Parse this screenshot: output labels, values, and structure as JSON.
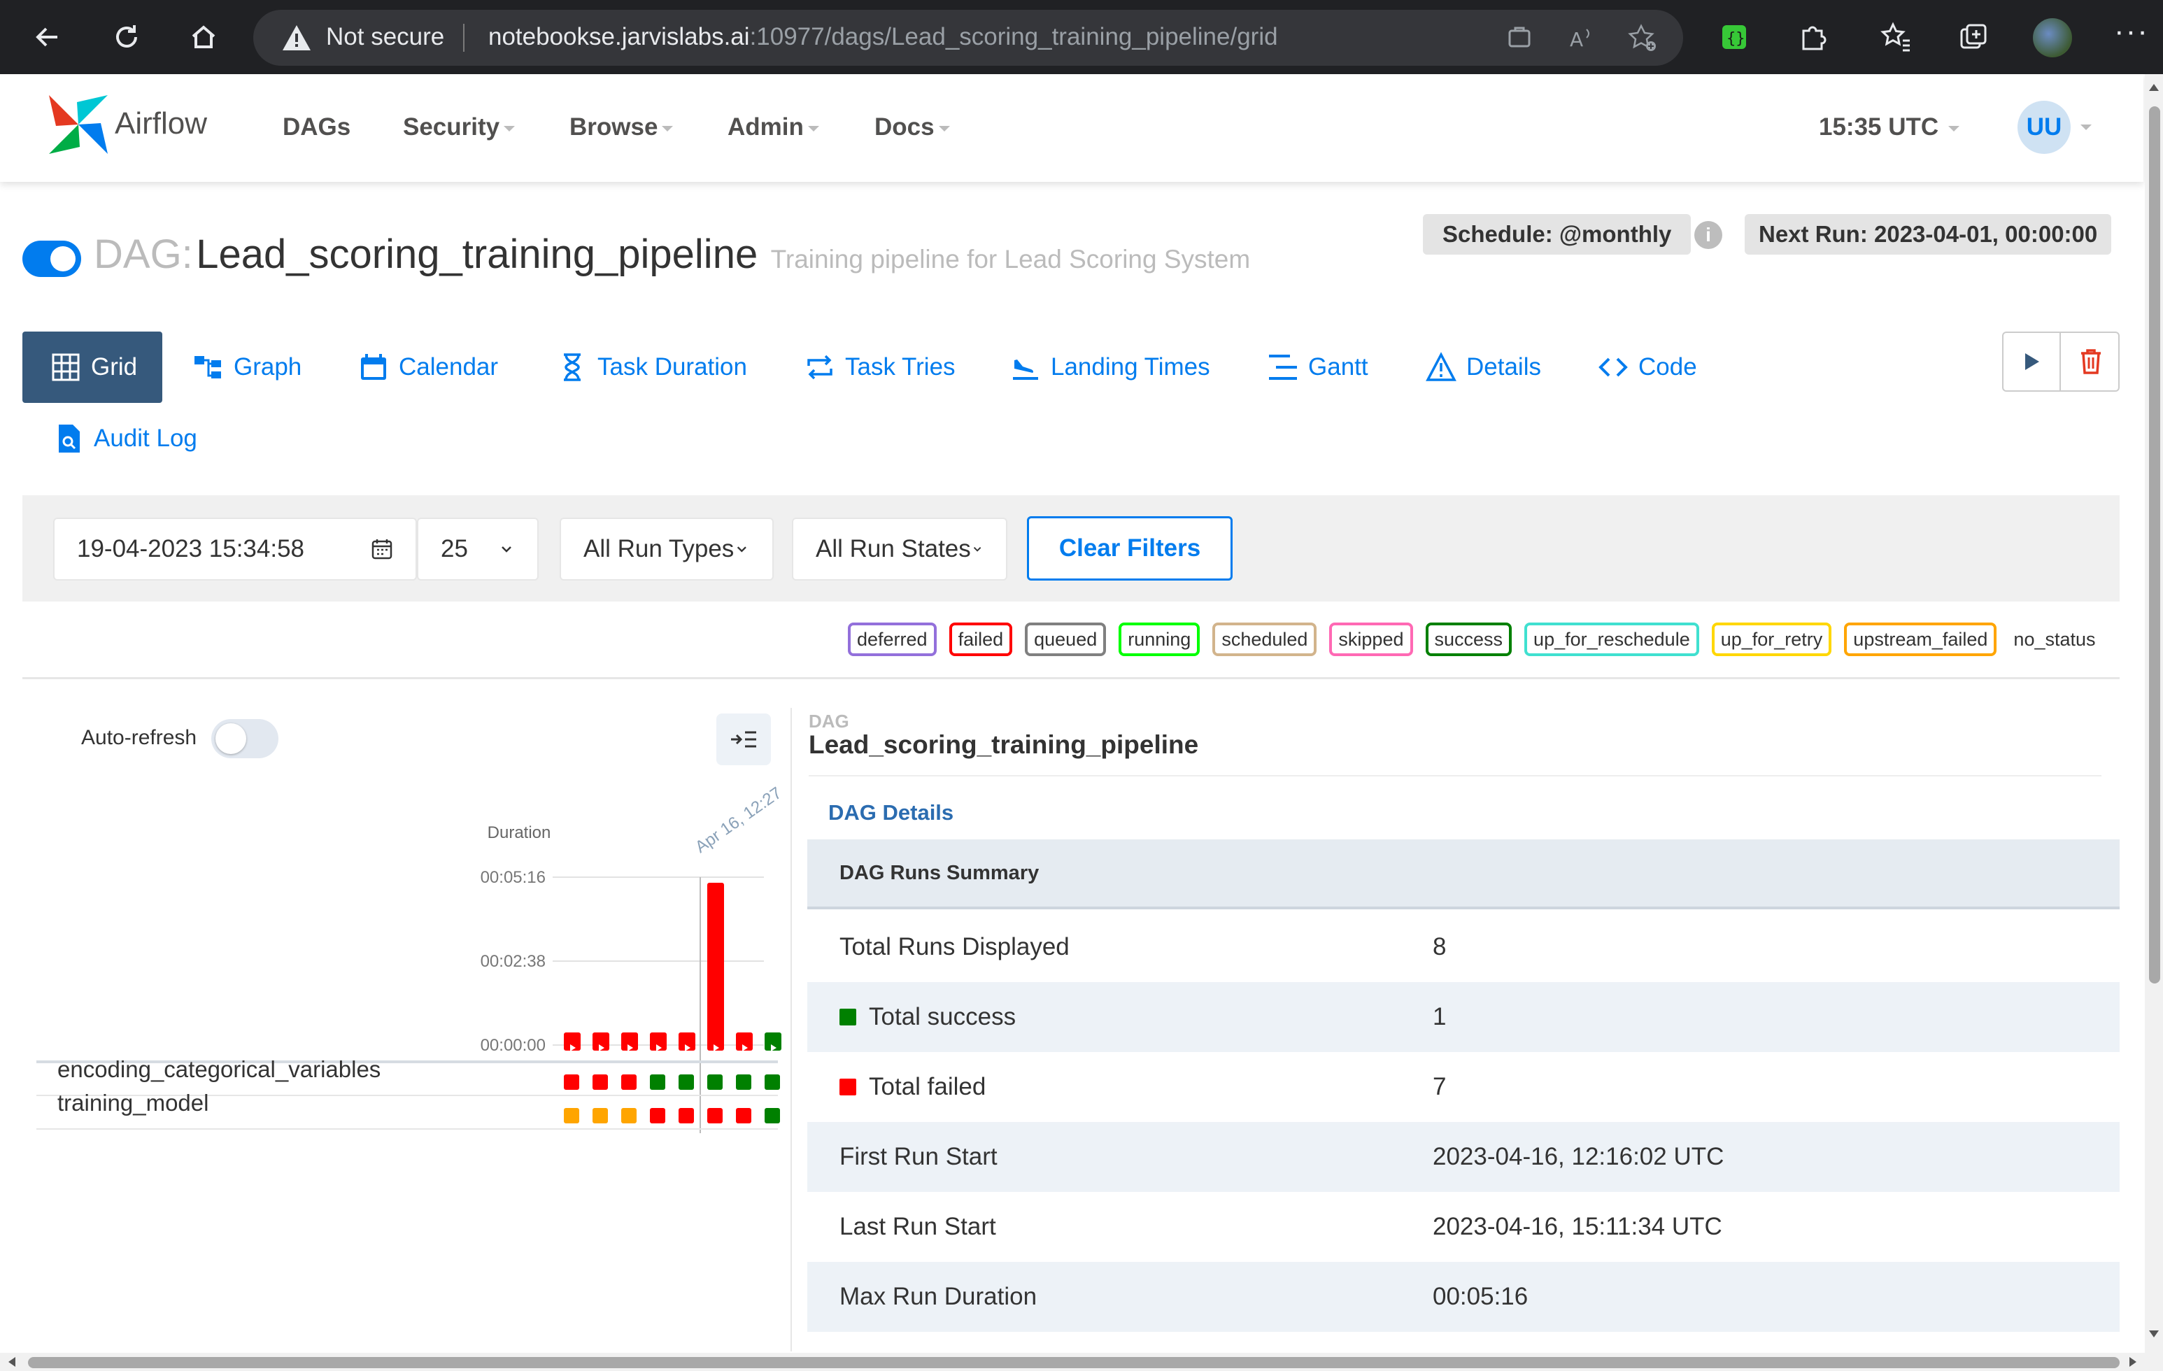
{
  "browser": {
    "security_label": "Not secure",
    "url_host": "notebookse.jarvislabs.ai",
    "url_path": ":10977/dags/Lead_scoring_training_pipeline/grid"
  },
  "nav": {
    "brand": "Airflow",
    "items": [
      {
        "label": "DAGs"
      },
      {
        "label": "Security"
      },
      {
        "label": "Browse"
      },
      {
        "label": "Admin"
      },
      {
        "label": "Docs"
      }
    ],
    "clock": "15:35 UTC",
    "user_initials": "UU"
  },
  "dag": {
    "prefix": "DAG:",
    "name": "Lead_scoring_training_pipeline",
    "description": "Training pipeline for Lead Scoring System",
    "schedule": "Schedule: @monthly",
    "next_run": "Next Run: 2023-04-01, 00:00:00",
    "paused": false
  },
  "tabs": [
    {
      "label": "Grid",
      "icon": "grid-icon",
      "active": true
    },
    {
      "label": "Graph",
      "icon": "graph-icon"
    },
    {
      "label": "Calendar",
      "icon": "calendar-icon"
    },
    {
      "label": "Task Duration",
      "icon": "hourglass-icon"
    },
    {
      "label": "Task Tries",
      "icon": "repeat-icon"
    },
    {
      "label": "Landing Times",
      "icon": "plane-landing-icon"
    },
    {
      "label": "Gantt",
      "icon": "gantt-icon"
    },
    {
      "label": "Details",
      "icon": "warning-triangle-icon"
    },
    {
      "label": "Code",
      "icon": "code-icon"
    },
    {
      "label": "Audit Log",
      "icon": "file-search-icon"
    }
  ],
  "filters": {
    "base_date": "19-04-2023 15:34:58",
    "num_runs": "25",
    "run_types": "All Run Types",
    "run_states": "All Run States",
    "clear_label": "Clear Filters"
  },
  "legend": [
    {
      "label": "deferred",
      "color": "#9370db"
    },
    {
      "label": "failed",
      "color": "#ff0000"
    },
    {
      "label": "queued",
      "color": "#808080"
    },
    {
      "label": "running",
      "color": "#00ff00"
    },
    {
      "label": "scheduled",
      "color": "#d2b48c"
    },
    {
      "label": "skipped",
      "color": "#ff69b4"
    },
    {
      "label": "success",
      "color": "#008000"
    },
    {
      "label": "up_for_reschedule",
      "color": "#40e0d0"
    },
    {
      "label": "up_for_retry",
      "color": "#ffd700"
    },
    {
      "label": "upstream_failed",
      "color": "#ffa500"
    },
    {
      "label": "no_status",
      "color": ""
    }
  ],
  "grid": {
    "auto_refresh_label": "Auto-refresh",
    "auto_refresh_on": false,
    "duration_label": "Duration",
    "y_ticks": [
      "00:05:16",
      "00:02:38",
      "00:00:00"
    ],
    "max_seconds": 316,
    "hover_date": "Apr 16, 12:27",
    "runs": [
      {
        "state": "failed",
        "seconds": 14
      },
      {
        "state": "failed",
        "seconds": 12
      },
      {
        "state": "failed",
        "seconds": 12
      },
      {
        "state": "failed",
        "seconds": 12
      },
      {
        "state": "failed",
        "seconds": 12
      },
      {
        "state": "failed",
        "seconds": 316,
        "selected": true
      },
      {
        "state": "failed",
        "seconds": 12
      },
      {
        "state": "success",
        "seconds": 12
      }
    ],
    "tasks": [
      {
        "name": "encoding_categorical_variables",
        "states": [
          "failed",
          "failed",
          "failed",
          "success",
          "success",
          "success",
          "success",
          "success"
        ]
      },
      {
        "name": "training_model",
        "states": [
          "upstream_failed",
          "upstream_failed",
          "upstream_failed",
          "failed",
          "failed",
          "failed",
          "failed",
          "success"
        ]
      }
    ]
  },
  "details": {
    "small_label": "DAG",
    "dag_name": "Lead_scoring_training_pipeline",
    "details_link": "DAG Details",
    "summary_title": "DAG Runs Summary",
    "rows": [
      {
        "key": "Total Runs Displayed",
        "value": "8"
      },
      {
        "key": "Total success",
        "value": "1",
        "swatch": "#008000"
      },
      {
        "key": "Total failed",
        "value": "7",
        "swatch": "#ff0000"
      },
      {
        "key": "First Run Start",
        "value": "2023-04-16, 12:16:02 UTC"
      },
      {
        "key": "Last Run Start",
        "value": "2023-04-16, 15:11:34 UTC"
      },
      {
        "key": "Max Run Duration",
        "value": "00:05:16"
      }
    ]
  },
  "colors": {
    "accent": "#017cee",
    "active_tab": "#36597c",
    "failed": "#ff0000",
    "success": "#008000",
    "upstream_failed": "#ffa500"
  }
}
